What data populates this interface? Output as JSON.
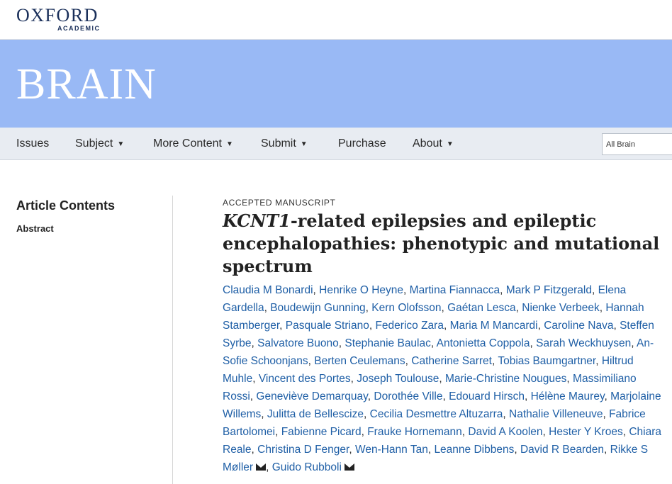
{
  "header": {
    "logo_main": "OXFORD",
    "logo_sub": "ACADEMIC"
  },
  "banner": {
    "journal_title": "BRAIN",
    "background_color": "#99b9f5"
  },
  "nav": {
    "items": [
      {
        "label": "Issues",
        "has_dropdown": false
      },
      {
        "label": "Subject",
        "has_dropdown": true
      },
      {
        "label": "More Content",
        "has_dropdown": true
      },
      {
        "label": "Submit",
        "has_dropdown": true
      },
      {
        "label": "Purchase",
        "has_dropdown": false
      },
      {
        "label": "About",
        "has_dropdown": true
      }
    ],
    "dropdown_glyph": "▼",
    "search_scope": "All Brain"
  },
  "sidebar": {
    "title": "Article Contents",
    "links": [
      "Abstract"
    ]
  },
  "article": {
    "kicker": "ACCEPTED MANUSCRIPT",
    "title_italic": "KCNT1",
    "title_rest": "-related epilepsies and epileptic encephalopathies: phenotypic and mutational spectrum",
    "link_color": "#1f5fa6",
    "authors": [
      "Claudia M Bonardi",
      "Henrike O Heyne",
      "Martina Fiannacca",
      "Mark P Fitzgerald",
      "Elena Gardella",
      "Boudewijn Gunning",
      "Kern Olofsson",
      "Gaétan Lesca",
      "Nienke Verbeek",
      "Hannah Stamberger",
      "Pasquale Striano",
      "Federico Zara",
      "Maria M Mancardi",
      "Caroline Nava",
      "Steffen Syrbe",
      "Salvatore Buono",
      "Stephanie Baulac",
      "Antonietta Coppola",
      "Sarah Weckhuysen",
      "An-Sofie Schoonjans",
      "Berten Ceulemans",
      "Catherine Sarret",
      "Tobias Baumgartner",
      "Hiltrud Muhle",
      "Vincent des Portes",
      "Joseph Toulouse",
      "Marie-Christine Nougues",
      "Massimiliano Rossi",
      "Geneviève Demarquay",
      "Dorothée Ville",
      "Edouard Hirsch",
      "Hélène Maurey",
      "Marjolaine Willems",
      "Julitta de Bellescize",
      "Cecilia Desmettre Altuzarra",
      "Nathalie Villeneuve",
      "Fabrice Bartolomei",
      "Fabienne Picard",
      "Frauke Hornemann",
      "David A Koolen",
      "Hester Y Kroes",
      "Chiara Reale",
      "Christina D Fenger",
      "Wen-Hann Tan",
      "Leanne Dibbens",
      "David R Bearden",
      "Rikke S Møller",
      "Guido Rubboli"
    ],
    "corresponding_authors": [
      "Rikke S Møller",
      "Guido Rubboli"
    ],
    "corresponding_icon": "envelope-icon"
  }
}
